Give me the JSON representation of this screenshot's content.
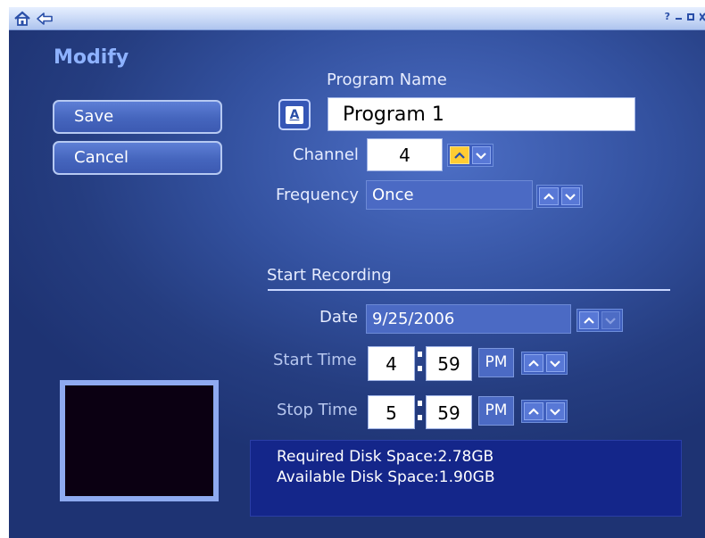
{
  "page": {
    "title": "Modify"
  },
  "titlebar": {
    "help": "?"
  },
  "actions": {
    "save_label": "Save",
    "cancel_label": "Cancel"
  },
  "program": {
    "name_label": "Program Name",
    "name_value": "Program 1",
    "keyboard_button_label": "A"
  },
  "channel": {
    "label": "Channel",
    "value": "4"
  },
  "frequency": {
    "label": "Frequency",
    "value": "Once"
  },
  "start_recording": {
    "section_title": "Start Recording",
    "date_label": "Date",
    "date_value": "9/25/2006",
    "start_time_label": "Start Time",
    "start_hour": "4",
    "start_minute": "59",
    "start_ampm": "PM",
    "stop_time_label": "Stop Time",
    "stop_hour": "5",
    "stop_minute": "59",
    "stop_ampm": "PM"
  },
  "disk": {
    "required": "Required Disk Space:2.78GB",
    "available": "Available Disk Space:1.90GB"
  },
  "colors": {
    "background": "#33519f",
    "accent_highlight": "#ffcc33",
    "title_color": "#8eb2ff",
    "disk_panel": "#14268a"
  },
  "icons": [
    "home-icon",
    "back-arrow-icon",
    "help-icon",
    "minimize-icon",
    "maximize-icon",
    "close-icon",
    "chevron-up-icon",
    "chevron-down-icon",
    "keyboard-icon"
  ]
}
